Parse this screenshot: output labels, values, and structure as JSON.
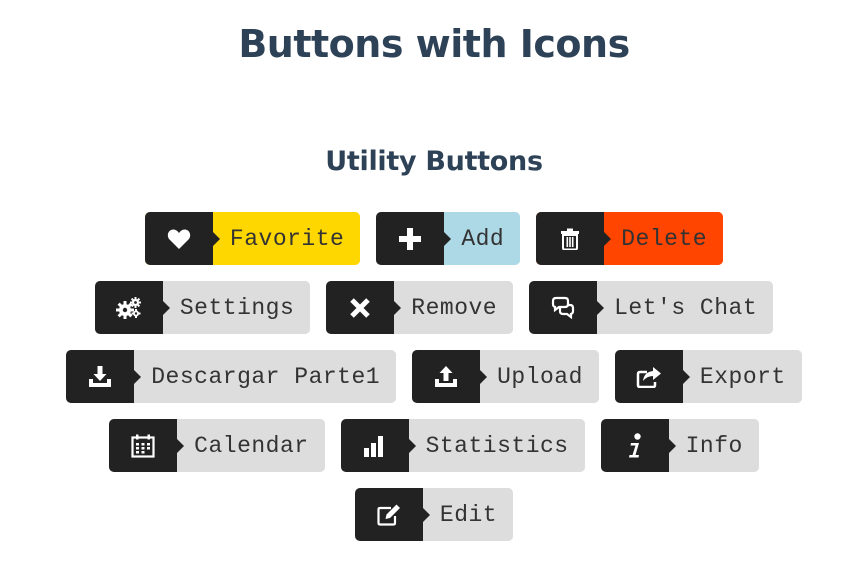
{
  "page": {
    "title": "Buttons with Icons",
    "section_title": "Utility Buttons"
  },
  "buttons": [
    {
      "label": "Favorite",
      "icon": "heart-icon",
      "bg": "#ffd700"
    },
    {
      "label": "Add",
      "icon": "plus-icon",
      "bg": "#add8e6"
    },
    {
      "label": "Delete",
      "icon": "trash-icon",
      "bg": "#ff4500"
    },
    {
      "label": "Settings",
      "icon": "cogs-icon",
      "bg": "#dddddd"
    },
    {
      "label": "Remove",
      "icon": "close-icon",
      "bg": "#dddddd"
    },
    {
      "label": "Let's Chat",
      "icon": "chat-icon",
      "bg": "#dddddd"
    },
    {
      "label": "Descargar Parte1",
      "icon": "download-icon",
      "bg": "#dddddd"
    },
    {
      "label": "Upload",
      "icon": "upload-icon",
      "bg": "#dddddd"
    },
    {
      "label": "Export",
      "icon": "export-icon",
      "bg": "#dddddd"
    },
    {
      "label": "Calendar",
      "icon": "calendar-icon",
      "bg": "#dddddd"
    },
    {
      "label": "Statistics",
      "icon": "bar-chart-icon",
      "bg": "#dddddd"
    },
    {
      "label": "Info",
      "icon": "info-icon",
      "bg": "#dddddd"
    },
    {
      "label": "Edit",
      "icon": "edit-icon",
      "bg": "#dddddd"
    }
  ],
  "colors": {
    "icon_box": "#222222",
    "title": "#2e4257"
  }
}
